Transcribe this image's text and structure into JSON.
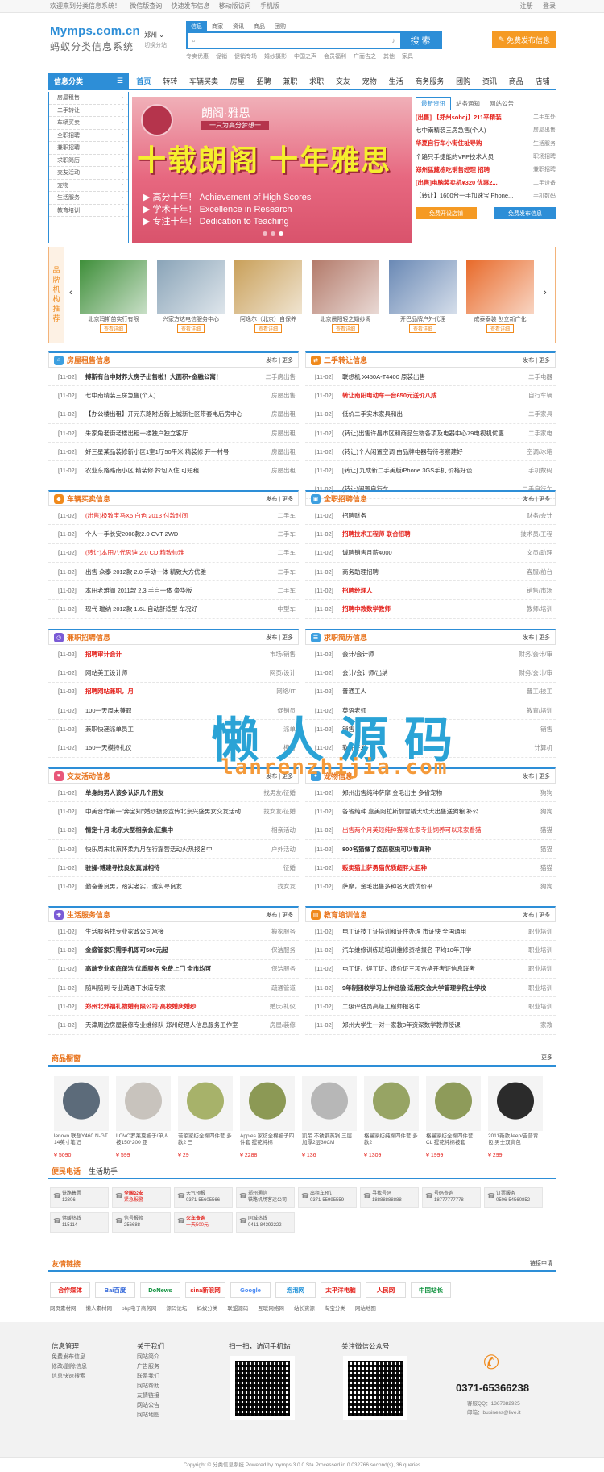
{
  "topbar": {
    "welcome": "欢迎来到分类信息系统！",
    "links": [
      "微信版查询",
      "快速发布信息",
      "移动版访问",
      "手机版"
    ],
    "login": "注册",
    "logout": "登录"
  },
  "header": {
    "logo": "Mymps.com.cn",
    "subtitle": "蚂蚁分类信息系统",
    "city": "郑州",
    "city_switch": "切换分站",
    "search_tabs": [
      "信息",
      "商家",
      "资讯",
      "商品",
      "团购"
    ],
    "search_button": "搜 索",
    "hotwords": [
      "专卖优惠",
      "促销",
      "促销专场",
      "婚纱摄影",
      "中国之声",
      "会员福利",
      "广而告之",
      "其他",
      "家具"
    ],
    "post_button": "免费发布信息"
  },
  "nav": {
    "category_label": "信息分类",
    "items": [
      "首页",
      "转转",
      "车辆买卖",
      "房屋",
      "招聘",
      "兼职",
      "求职",
      "交友",
      "宠物",
      "生活",
      "商务服务",
      "团购",
      "资讯",
      "商品",
      "店铺"
    ]
  },
  "sidebar": {
    "items": [
      "房屋租售",
      "二手转让",
      "车辆买卖",
      "全职招聘",
      "兼职招聘",
      "求职简历",
      "交友活动",
      "宠物",
      "生活服务",
      "教育培训"
    ]
  },
  "banner": {
    "brand": "朗阁·雅思",
    "slogan": "一只为高分梦想一",
    "big": "十载朗阁 十年雅思",
    "lines": [
      "▶ 高分十年！ Achievement of High Scores",
      "▶ 学术十年！ Excellence in Research",
      "▶ 专注十年！ Dedication to Teaching"
    ]
  },
  "news": {
    "tabs": [
      "最新资讯",
      "站务通知",
      "网站公告"
    ],
    "items": [
      {
        "t": "[出售] 【郑州sohoj】211平精装",
        "m": "二手车处",
        "red": true
      },
      {
        "t": "七中南精装三房急售(个人)",
        "m": "房屋出售",
        "red": false
      },
      {
        "t": "华夏自行车小街住址导购",
        "m": "生活服务",
        "red": true
      },
      {
        "t": "个路只手捷能的VFP技术人员",
        "m": "职场招聘",
        "red": false
      },
      {
        "t": "郑州猛藏栋吃销售经理 招聘",
        "m": "兼职招聘",
        "red": true
      },
      {
        "t": "[出售]电脑装卖机¥320 优惠2...",
        "m": "二手设备",
        "red": true
      },
      {
        "t": "【转让】1600台一手加速宝iPhone...",
        "m": "手机数码",
        "red": false
      }
    ],
    "btn_shop": "免费开设店铺",
    "btn_post": "免费发布信息"
  },
  "brands": {
    "label": "品牌机构推荐",
    "items": [
      {
        "name": "北京玛斯苗实行有限",
        "btn": "查看详细"
      },
      {
        "name": "兴家方达电信服务中心",
        "btn": "查看详细"
      },
      {
        "name": "阿逸尔（北京）自保养",
        "btn": "查看详细"
      },
      {
        "name": "北京晨阳轻之婚纱阁",
        "btn": "查看详细"
      },
      {
        "name": "开巴品牌户外代理",
        "btn": "查看详细"
      },
      {
        "name": "成泰泰装 创立新广化",
        "btn": "查看详细"
      }
    ]
  },
  "sections": [
    {
      "title": "房屋租售信息",
      "icon": "house-icon",
      "color": "#3c9fe0",
      "more": "发布 | 更多",
      "rows": [
        {
          "d": "[11-02]",
          "t": "搏斯有台中财养大房子出售啦！大面积+金融公寓！",
          "c": "二手房出售",
          "s": "bold"
        },
        {
          "d": "[11-02]",
          "t": "七中南精装三房急售(个人)",
          "c": "房屋出售",
          "s": ""
        },
        {
          "d": "[11-02]",
          "t": "【办公楼出租】开元东路附近新上城新社区带套电后房中心",
          "c": "房屋出租",
          "s": ""
        },
        {
          "d": "[11-02]",
          "t": "朱家角老街老楼出租一楼独户独立客厅",
          "c": "房屋出租",
          "s": ""
        },
        {
          "d": "[11-02]",
          "t": "好三星某品装修新小区1室1厅50平米 精装修 开一村号",
          "c": "房屋出租",
          "s": ""
        },
        {
          "d": "[11-02]",
          "t": "农业东路路南小区 精装修 拎包入住 可短租",
          "c": "房屋出租",
          "s": ""
        }
      ]
    },
    {
      "title": "二手转让信息",
      "icon": "swap-icon",
      "color": "#f08a1c",
      "more": "发布 | 更多",
      "rows": [
        {
          "d": "[11-02]",
          "t": "联想机 X450A-T4400 原装出售",
          "c": "二手电器",
          "s": ""
        },
        {
          "d": "[11-02]",
          "t": "转让南阳电动车一台650元送价八成",
          "c": "自行车辆",
          "s": "red bold"
        },
        {
          "d": "[11-02]",
          "t": "低价二手实木家具和出",
          "c": "二手家具",
          "s": ""
        },
        {
          "d": "[11-02]",
          "t": "(转让)出售许昌市区和商品生物各项及电器中心79电视机优惠",
          "c": "二手家电",
          "s": ""
        },
        {
          "d": "[11-02]",
          "t": "(转让)个人闲置空调 由品牌电器有待考察建好",
          "c": "空调/冰箱",
          "s": ""
        },
        {
          "d": "[11-02]",
          "t": "[转让] 九成新二手美版iPhone 3GS手机 价格好谈",
          "c": "手机数码",
          "s": ""
        },
        {
          "d": "[11-02]",
          "t": "(转让)闲置自行车",
          "c": "二手自行车",
          "s": ""
        }
      ]
    },
    {
      "title": "车辆买卖信息",
      "icon": "car-icon",
      "color": "#f08a1c",
      "more": "发布 | 更多",
      "rows": [
        {
          "d": "[11-02]",
          "t": "(出售)极致宝马X5 白色 2013 付款时间",
          "c": "二手车",
          "s": "red"
        },
        {
          "d": "[11-02]",
          "t": "个人一手长安2008款2.0 CVT 2WD",
          "c": "二手车",
          "s": ""
        },
        {
          "d": "[11-02]",
          "t": "(转让)本田八代思迪 2.0 CD 精致帅雅",
          "c": "二手车",
          "s": "red"
        },
        {
          "d": "[11-02]",
          "t": "出售 众泰 2012款 2.0 手动一体 精致大方优雅",
          "c": "二手车",
          "s": ""
        },
        {
          "d": "[11-02]",
          "t": "本田老雅阁 2011款 2.3 手自一体 豪华版",
          "c": "二手车",
          "s": ""
        },
        {
          "d": "[11-02]",
          "t": "现代 瑞纳 2012款 1.6L 自动舒适型 车况好",
          "c": "中型车",
          "s": ""
        }
      ]
    },
    {
      "title": "全职招聘信息",
      "icon": "briefcase-icon",
      "color": "#3c9fe0",
      "more": "发布 | 更多",
      "rows": [
        {
          "d": "[11-02]",
          "t": "招聘财务",
          "c": "财务/会计",
          "s": ""
        },
        {
          "d": "[11-02]",
          "t": "招聘技术工程师 联合招聘",
          "c": "技术员/工程",
          "s": "red bold"
        },
        {
          "d": "[11-02]",
          "t": "诚聘销售月薪4000",
          "c": "文员/助理",
          "s": ""
        },
        {
          "d": "[11-02]",
          "t": "商务助理招聘",
          "c": "客服/前台",
          "s": ""
        },
        {
          "d": "[11-02]",
          "t": "招聘经理人",
          "c": "销售/市场",
          "s": "red bold"
        },
        {
          "d": "[11-02]",
          "t": "招聘中教数学教师",
          "c": "教师/培训",
          "s": "red bold"
        }
      ]
    },
    {
      "title": "兼职招聘信息",
      "icon": "clock-icon",
      "color": "#7b5bd6",
      "more": "发布 | 更多",
      "rows": [
        {
          "d": "[11-02]",
          "t": "招聘审计会计",
          "c": "市场/销售",
          "s": "red bold"
        },
        {
          "d": "[11-02]",
          "t": "网站美工设计师",
          "c": "网页/设计",
          "s": ""
        },
        {
          "d": "[11-02]",
          "t": "招聘网站兼职，月",
          "c": "网络/IT",
          "s": "red bold"
        },
        {
          "d": "[11-02]",
          "t": "100一天周末兼职",
          "c": "促销员",
          "s": ""
        },
        {
          "d": "[11-02]",
          "t": "兼职快递派单员工",
          "c": "派单",
          "s": ""
        },
        {
          "d": "[11-02]",
          "t": "150一天模特礼仪",
          "c": "模特",
          "s": ""
        }
      ]
    },
    {
      "title": "求职简历信息",
      "icon": "resume-icon",
      "color": "#3c9fe0",
      "more": "发布 | 更多",
      "rows": [
        {
          "d": "[11-02]",
          "t": "会计/会计师",
          "c": "财务/会计/审",
          "s": ""
        },
        {
          "d": "[11-02]",
          "t": "会计/会计师/出纳",
          "c": "财务/会计/审",
          "s": ""
        },
        {
          "d": "[11-02]",
          "t": "普通工人",
          "c": "普工/技工",
          "s": ""
        },
        {
          "d": "[11-02]",
          "t": "英语老师",
          "c": "教育/培训",
          "s": ""
        },
        {
          "d": "[11-02]",
          "t": "销售",
          "c": "销售",
          "s": ""
        },
        {
          "d": "[11-02]",
          "t": "软件开发",
          "c": "计算机",
          "s": ""
        }
      ]
    },
    {
      "title": "交友活动信息",
      "icon": "heart-icon",
      "color": "#e8577a",
      "more": "发布 | 更多",
      "rows": [
        {
          "d": "[11-02]",
          "t": "单身的男人该多认识几个朋友",
          "c": "找男友/征婚",
          "s": "bold"
        },
        {
          "d": "[11-02]",
          "t": "中美合作第一\"奔宝知\"婚纱摄影宣传北京兴盛男女交友活动",
          "c": "找女友/征婚",
          "s": ""
        },
        {
          "d": "[11-02]",
          "t": "情定十月 北京大型相亲会,征集中",
          "c": "相亲活动",
          "s": "bold"
        },
        {
          "d": "[11-02]",
          "t": "快乐周末北京怀柔九月在行露营活动火热报名中",
          "c": "户外活动",
          "s": ""
        },
        {
          "d": "[11-02]",
          "t": "驻操-博建寻找良友真诚相待",
          "c": "征婚",
          "s": "bold"
        },
        {
          "d": "[11-02]",
          "t": "勤奋善良男，踏实老实，诚实寻良友",
          "c": "找女友",
          "s": ""
        }
      ]
    },
    {
      "title": "宠物信息",
      "icon": "paw-icon",
      "color": "#3c9fe0",
      "more": "发布 | 更多",
      "rows": [
        {
          "d": "[11-02]",
          "t": "郑州出售纯种萨摩 金毛出生 多省宠物",
          "c": "狗狗",
          "s": ""
        },
        {
          "d": "[11-02]",
          "t": "各省纯种 嘉美阿拉斯加雪橇犬幼犬出售送狗粮 补公",
          "c": "狗狗",
          "s": ""
        },
        {
          "d": "[11-02]",
          "t": "出售两个月英短纯种猫咪在家专业饲养可以来家看猫",
          "c": "猫猫",
          "s": "red"
        },
        {
          "d": "[11-02]",
          "t": "800名猫做了疫苗驱虫可以看真种",
          "c": "猫猫",
          "s": "bold"
        },
        {
          "d": "[11-02]",
          "t": "贩卖猫上萨勇猫优质超胖大胆种",
          "c": "猫猫",
          "s": "red bold"
        },
        {
          "d": "[11-02]",
          "t": "萨摩，金毛出售多种名犬质优价平",
          "c": "狗狗",
          "s": ""
        }
      ]
    },
    {
      "title": "生活服务信息",
      "icon": "service-icon",
      "color": "#7b5bd6",
      "more": "发布 | 更多",
      "rows": [
        {
          "d": "[11-02]",
          "t": "生活服务找专业家政公司承接",
          "c": "搬家服务",
          "s": ""
        },
        {
          "d": "[11-02]",
          "t": "金盛管家只需手机即可500元起",
          "c": "保洁服务",
          "s": "bold"
        },
        {
          "d": "[11-02]",
          "t": "高端专业家庭保洁 优质服务 免费上门 全市均可",
          "c": "保洁服务",
          "s": "bold"
        },
        {
          "d": "[11-02]",
          "t": "随叫随到 专业疏通下水道专家",
          "c": "疏通管道",
          "s": ""
        },
        {
          "d": "[11-02]",
          "t": "郑州北郊福礼物婚有限公司·高校婚庆婚纱",
          "c": "婚庆/礼仪",
          "s": "red bold"
        },
        {
          "d": "[11-02]",
          "t": "天津周边房屋装修专业维修队 郑州经理人信息服务工作室",
          "c": "房屋/装修",
          "s": ""
        }
      ]
    },
    {
      "title": "教育培训信息",
      "icon": "book-icon",
      "color": "#f08a1c",
      "more": "发布 | 更多",
      "rows": [
        {
          "d": "[11-02]",
          "t": "电工证技工证培训和证件办理 市证快 全国通用",
          "c": "职业培训",
          "s": ""
        },
        {
          "d": "[11-02]",
          "t": "汽车维修训练班培训维修资格报名 平均10年开学",
          "c": "职业培训",
          "s": ""
        },
        {
          "d": "[11-02]",
          "t": "电工证、焊工证、造价证三项合格开考证信息联考",
          "c": "职业培训",
          "s": ""
        },
        {
          "d": "[11-02]",
          "t": "9年制团校学习上作经验 适用交会大学管理学院土学校",
          "c": "职业培训",
          "s": "bold"
        },
        {
          "d": "[11-02]",
          "t": "二级评估员高级工程师报名中",
          "c": "职业培训",
          "s": ""
        },
        {
          "d": "[11-02]",
          "t": "郑州大学生一对一家教3年资深数学教师授课",
          "c": "家教",
          "s": ""
        }
      ]
    }
  ],
  "watermark": {
    "cn": "懒人源码",
    "en": "lanrenzhijia.com"
  },
  "products": {
    "title": "商品橱窗",
    "more": "更多",
    "items": [
      {
        "n": "lenovo 联想Y460 N-GT 14英寸笔记",
        "p": "¥ 5090",
        "c": "#5c6b7a"
      },
      {
        "n": "LOVO罗莱夏被子/单人被150*200 亚",
        "p": "¥ 599",
        "c": "#c8c3bd"
      },
      {
        "n": "若狼家纺全棉四件套 多款2 三",
        "p": "¥ 29",
        "c": "#a7b26a"
      },
      {
        "n": "Apples 家纺全棉被子四件套 提花纯棉",
        "p": "¥ 2288",
        "c": "#8c9955"
      },
      {
        "n": "凯帝 不锈钢蒸锅 三层 加厚2层30CM",
        "p": "¥ 136",
        "c": "#b7b7b7"
      },
      {
        "n": "格曼家纺纯棉四件套 多款2",
        "p": "¥ 1309",
        "c": "#97a464"
      },
      {
        "n": "格曼家纺全棉四件套 CL 提花纯棉被套",
        "p": "¥ 1999",
        "c": "#8e9b5a"
      },
      {
        "n": "2011新款Jeep/吉普背包 男士双肩包",
        "p": "¥ 299",
        "c": "#2b2b2b"
      }
    ]
  },
  "phones": {
    "tabs": [
      "便民电话",
      "生活助手"
    ],
    "items": [
      {
        "a": "铁路售票",
        "b": "12306"
      },
      {
        "a": "全国公安",
        "b": "紧急报警",
        "red": true
      },
      {
        "a": "天气预报",
        "b": "0371-55605566"
      },
      {
        "a": "郑州通信",
        "b": "铁路机场客运公司"
      },
      {
        "a": "出租车预订",
        "b": "0371-55995559"
      },
      {
        "a": "寻找号码",
        "b": "18888888888"
      },
      {
        "a": "号码查询",
        "b": "18777777778"
      },
      {
        "a": "订票服务",
        "b": "0506-54560852"
      },
      {
        "a": "供暖热线",
        "b": "115114"
      },
      {
        "a": "信号报修",
        "b": "256688"
      },
      {
        "a": "火车查询",
        "b": "一天500元",
        "red": true
      },
      {
        "a": "同城热线",
        "b": "0411-84392222"
      }
    ]
  },
  "links": {
    "title": "友情链接",
    "more": "链接申请",
    "logos": [
      {
        "t": "合作媒体",
        "c": "#e4231d"
      },
      {
        "t": "Bai百度",
        "c": "#2d63d8"
      },
      {
        "t": "DoNews",
        "c": "#0b8f3a"
      },
      {
        "t": "sina新浪网",
        "c": "#e4231d"
      },
      {
        "t": "Google",
        "c": "#4285f4"
      },
      {
        "t": "泡泡网",
        "c": "#1a8fd8"
      },
      {
        "t": "太平洋电脑",
        "c": "#e4231d"
      },
      {
        "t": "人民网",
        "c": "#e4231d"
      },
      {
        "t": "中国站长",
        "c": "#0b8f3a"
      }
    ],
    "text": [
      "网页素材网",
      "懒人素材网",
      "php电子商务网",
      "源码论坛",
      "蚂蚁分类",
      "联盟源码",
      "互联网络网",
      "站长资源",
      "淘宝分类",
      "网站地图"
    ]
  },
  "footer": {
    "col1": {
      "h": "信息管理",
      "items": [
        "免费发布信息",
        "修改/删除信息",
        "信息快速搜索"
      ]
    },
    "col2": {
      "h": "关于我们",
      "items": [
        "网站简介",
        "广告服务",
        "联系我们",
        "网站帮助",
        "友情链接",
        "网站公告",
        "网站地图"
      ]
    },
    "qr1": "扫一扫，访问手机站",
    "qr2": "关注微信公众号",
    "tel": "0371-65366238",
    "qq": "客服QQ：1367882925",
    "mail": "邮箱：business@live.it",
    "copyright": "Copyright © 分类信息系统 Powered by mymps 3.0.0 Sta Processed in 0.032766 second(s), 36 queries"
  }
}
